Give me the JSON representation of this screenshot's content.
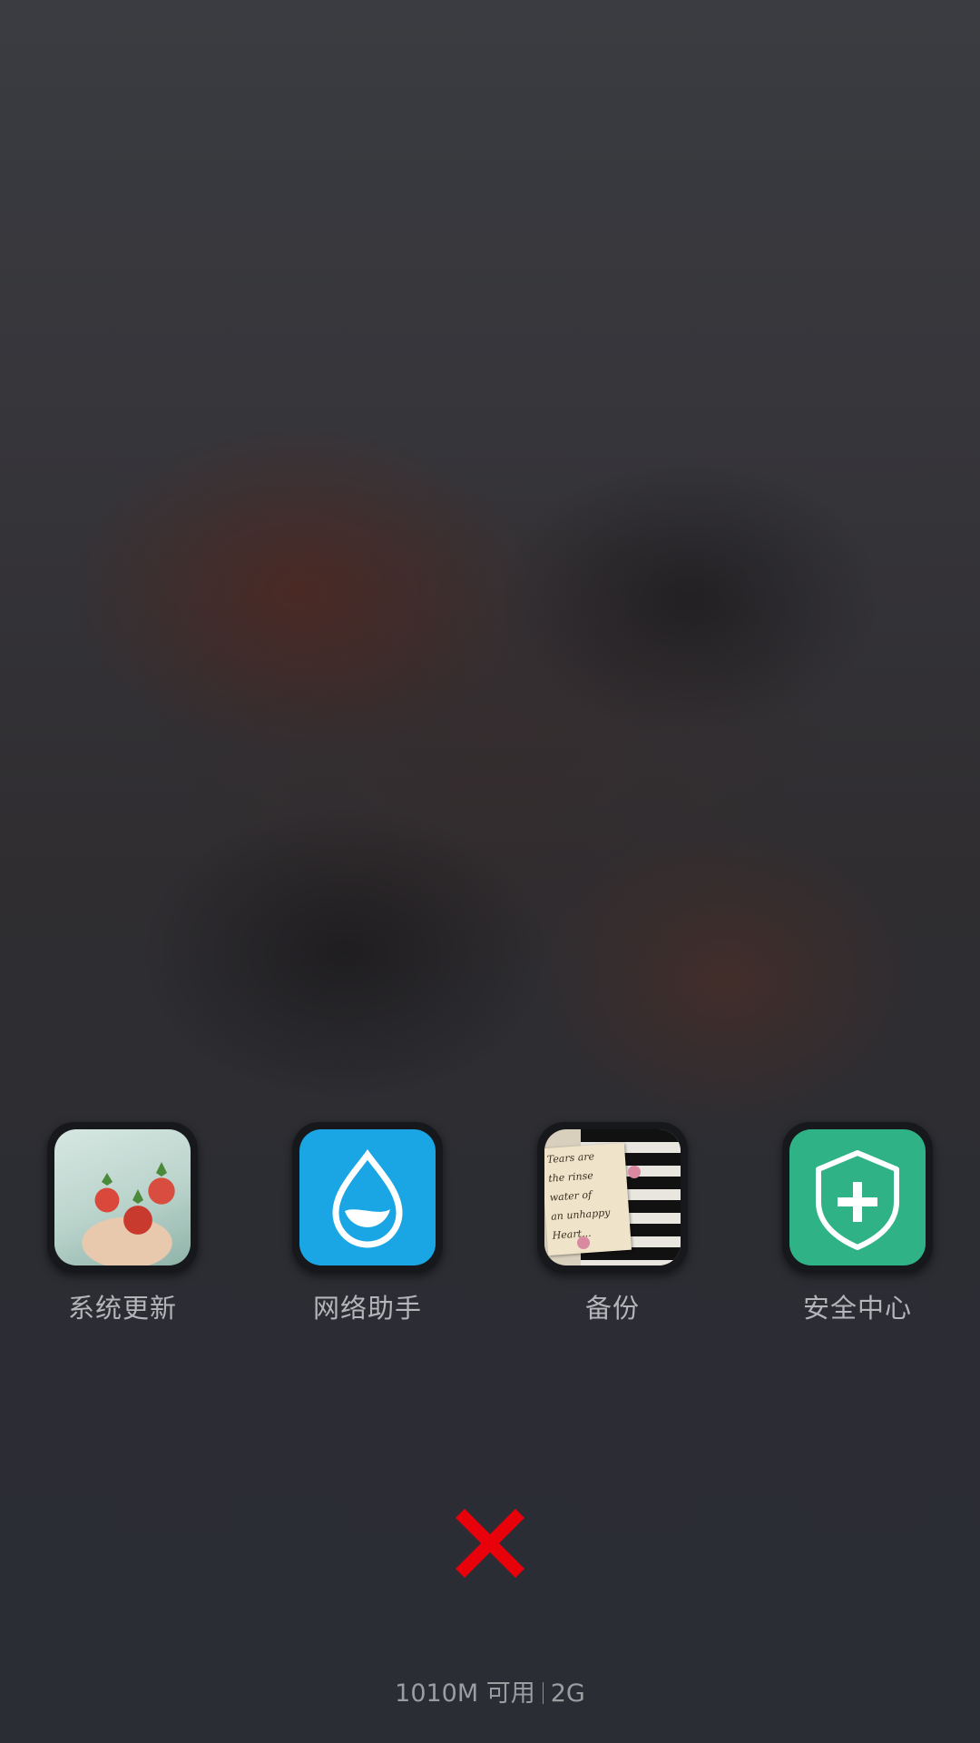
{
  "apps": [
    {
      "label": "系统更新",
      "icon": "strawberry-photo-icon"
    },
    {
      "label": "网络助手",
      "icon": "water-drop-icon"
    },
    {
      "label": "备份",
      "icon": "piano-photo-icon"
    },
    {
      "label": "安全中心",
      "icon": "shield-plus-icon"
    }
  ],
  "piano_note": [
    "Tears are",
    "the rinse",
    "water of",
    "an unhappy",
    "Heart..."
  ],
  "close": {
    "icon": "close-icon"
  },
  "status": {
    "memory_available": "1010M 可用",
    "memory_total": "2G"
  },
  "colors": {
    "close": "#e8000b",
    "drop_icon_bg": "#1aa6e4",
    "shield_icon_bg": "#2fb386",
    "label": "#b4b5b9"
  }
}
